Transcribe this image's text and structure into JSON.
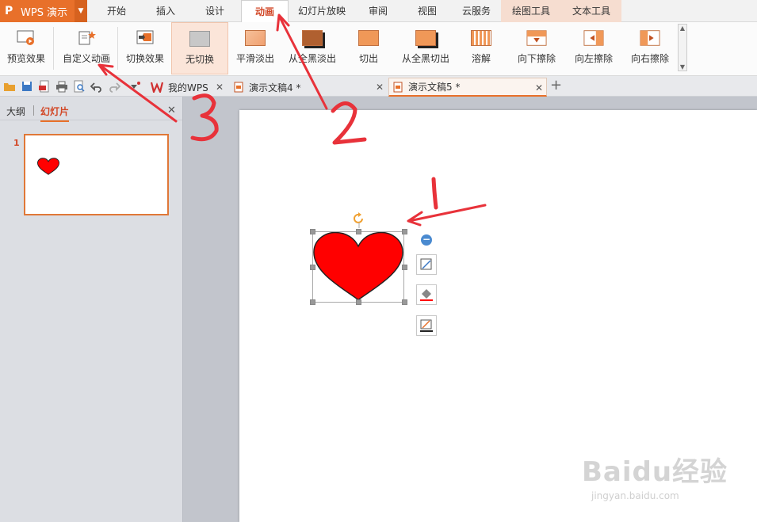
{
  "app": {
    "name": "WPS 演示",
    "logo": "P"
  },
  "menu_tabs": [
    "开始",
    "插入",
    "设计",
    "动画",
    "幻灯片放映",
    "审阅",
    "视图",
    "云服务",
    "绘图工具",
    "文本工具"
  ],
  "ribbon": {
    "preview_label": "预览效果",
    "custom_anim_label": "自定义动画",
    "switch_effect_label": "切换效果",
    "transitions": [
      "无切换",
      "平滑淡出",
      "从全黑淡出",
      "切出",
      "从全黑切出",
      "溶解",
      "向下擦除",
      "向左擦除",
      "向右擦除"
    ]
  },
  "doc_tabs": [
    "我的WPS",
    "演示文稿4 *",
    "演示文稿5 *"
  ],
  "left_panel": {
    "tab_outline": "大纲",
    "tab_slides": "幻灯片",
    "slide_number": "1"
  },
  "annotations": {
    "n1": "1",
    "n2": "2",
    "n3": "3"
  },
  "watermark": {
    "main": "Baidu经验",
    "sub": "jingyan.baidu.com"
  },
  "colors": {
    "accent": "#e8702a",
    "heart": "#ff0000",
    "arrow": "#e8323a"
  }
}
